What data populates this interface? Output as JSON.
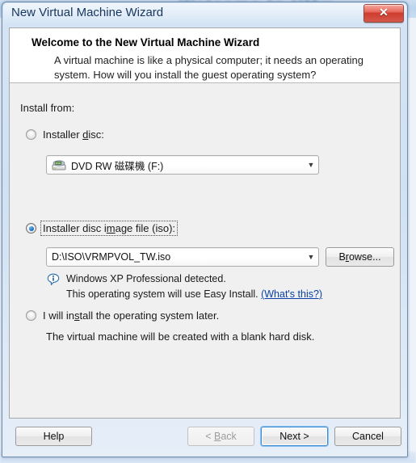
{
  "backdrop": {
    "text": "Welcome to VMw"
  },
  "window": {
    "title": "New Virtual Machine Wizard",
    "close_label": "✕",
    "close_icon": "close-icon"
  },
  "header": {
    "title": "Welcome to the New Virtual Machine Wizard",
    "description": "A virtual machine is like a physical computer; it needs an operating system. How will you install the guest operating system?"
  },
  "body": {
    "install_from_label": "Install from:",
    "option_disc": {
      "label_before": "Installer ",
      "accel": "d",
      "label_after": "isc:",
      "full_label": "Installer disc:",
      "checked": false,
      "combo": {
        "value": "DVD RW 磁碟機 (F:)",
        "icon": "dvd-drive-icon",
        "arrow": "▼"
      }
    },
    "option_iso": {
      "label_before": "Installer disc i",
      "accel": "m",
      "label_after": "age file (iso):",
      "full_label": "Installer disc image file (iso):",
      "checked": true,
      "focused": true,
      "combo": {
        "value": "D:\\ISO\\VRMPVOL_TW.iso",
        "arrow": "▼"
      },
      "browse_button": {
        "label_before": "B",
        "accel": "r",
        "label_after": "owse...",
        "full_label": "Browse..."
      },
      "info": {
        "icon": "info-icon",
        "line1": "Windows XP Professional detected.",
        "line2": "This operating system will use Easy Install.",
        "link": "(What's this?)"
      }
    },
    "option_later": {
      "label_before": "I will in",
      "accel": "s",
      "label_after": "tall the operating system later.",
      "full_label": "I will install the operating system later.",
      "checked": false,
      "sub_text": "The virtual machine will be created with a blank hard disk."
    }
  },
  "footer": {
    "help": "Help",
    "back_before": "< ",
    "back_accel": "B",
    "back_after": "ack",
    "back_full": "< Back",
    "back_disabled": true,
    "next": "Next >",
    "next_default": true,
    "cancel": "Cancel"
  },
  "colors": {
    "accent": "#3c8ad0",
    "link": "#0b41a6",
    "title_text": "#17365d",
    "close_red": "#cf3c2e",
    "panel_bg": "#f0f0f0"
  }
}
